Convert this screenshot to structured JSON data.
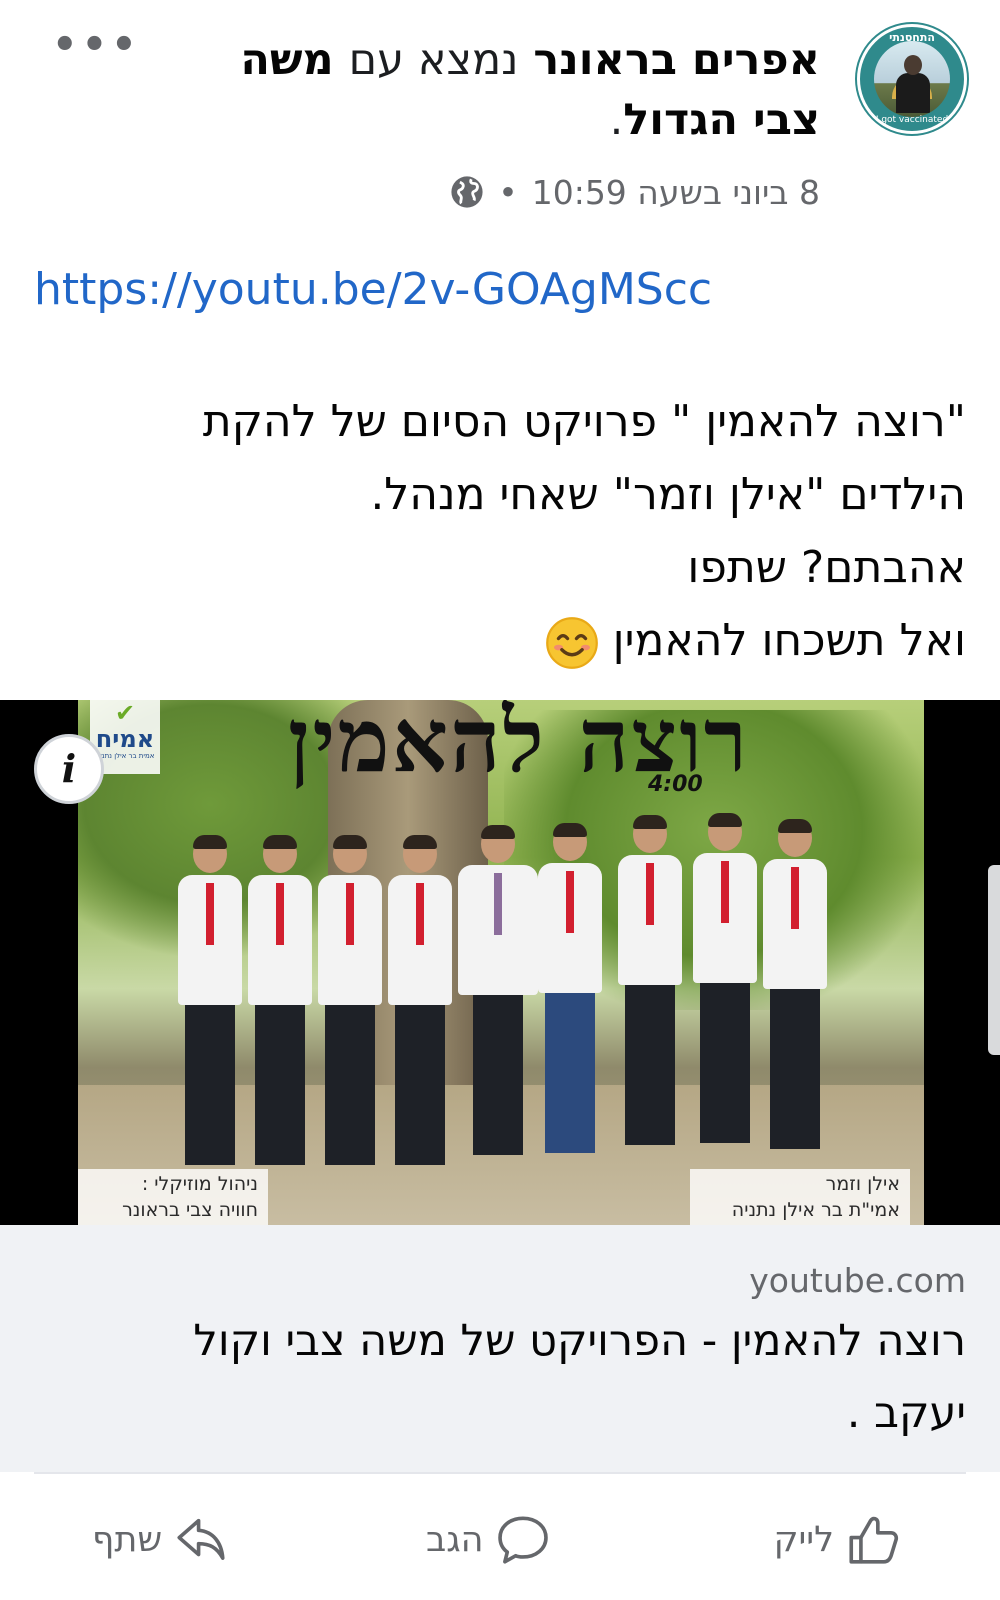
{
  "post": {
    "author": "אפרים בראונר",
    "with_text": "נמצא עם",
    "tagged": "משה צבי הגדול",
    "period": ".",
    "date_time": "8 ביוני בשעה 10:59",
    "separator": "•",
    "privacy_icon": "globe-icon",
    "avatar_text_top": "התחסנתי",
    "avatar_text_bottom": "I got vaccinated",
    "link": "https://youtu.be/2v-GOAgMScc",
    "text_lines": [
      "\"רוצה להאמין \" פרויקט הסיום של להקת הילדים \"אילן וזמר\" שאחי מנהל.",
      "אהבתם? שתפו",
      "ואל תשכחו להאמין"
    ],
    "emoji": "smiling-face-icon"
  },
  "preview": {
    "album_title": "רוצה להאמין",
    "duration": "4:00",
    "logo_name": "אמיח",
    "logo_sub": "אמית בר אילן נתניה",
    "credit_left_1": "ניהול מוזיקלי :",
    "credit_left_2": "חוויה צבי בראונר",
    "credit_right_1": "אילן וזמר",
    "credit_right_2": "אמי\"ת בר אילן נתניה",
    "info_label": "i"
  },
  "link_card": {
    "domain": "youtube.com",
    "title": "רוצה להאמין - הפרויקט של משה צבי וקול יעקב ."
  },
  "actions": {
    "like": "לייק",
    "comment": "הגב",
    "share": "שתף"
  },
  "colors": {
    "link": "#2167c8",
    "muted": "#65676b",
    "card_bg": "#f0f2f5",
    "avatar_ring": "#2f8a8c"
  }
}
